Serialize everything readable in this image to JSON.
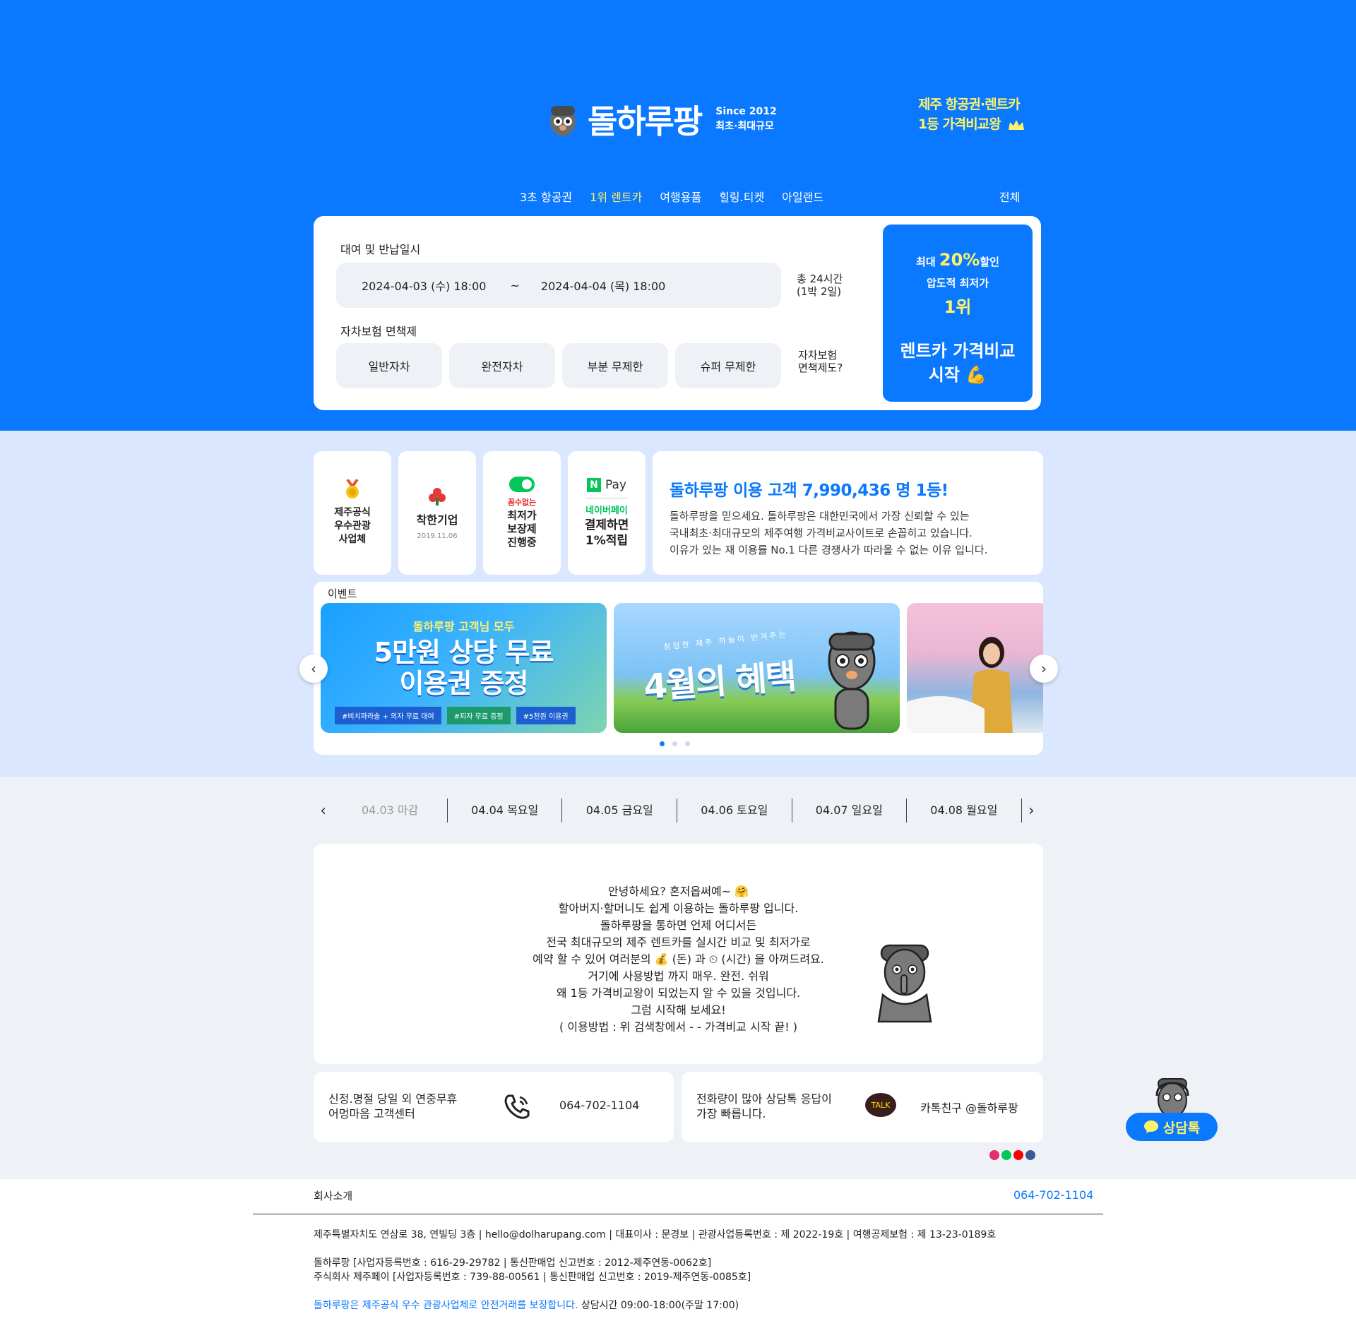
{
  "brand": {
    "name": "돌하루팡",
    "since": "Since 2012",
    "sub": "최초·최대규모",
    "tagline_1": "제주 항공권·렌트카",
    "tagline_2": "1등 가격비교왕"
  },
  "nav": {
    "items": [
      "3초 항공권",
      "1위 렌트카",
      "여행용품",
      "힐링.티켓",
      "아일랜드"
    ],
    "active_index": 1,
    "all": "전체"
  },
  "search": {
    "period_label": "대여 및 반납일시",
    "start": "2024-04-03 (수) 18:00",
    "separator": "~",
    "end": "2024-04-04 (목) 18:00",
    "total_1": "총 24시간",
    "total_2": "(1박 2일)",
    "insurance_label": "자차보험 면책제",
    "insurance_options": [
      "일반자차",
      "완전자차",
      "부분 무제한",
      "슈퍼 무제한"
    ],
    "insurance_q1": "자차보험",
    "insurance_q2": "면책제도?"
  },
  "cta": {
    "l1_pre": "최대 ",
    "l1_pct": "20%",
    "l1_post": "할인",
    "l2": "압도적 최저가",
    "l3": "1위",
    "l4a": "렌트카 가격비교",
    "l4b": "시작 💪"
  },
  "badges": {
    "b1": "제주공식\n우수관광\n사업체",
    "b2": "착한기업",
    "b2_date": "2019.11.06",
    "b3_small": "꼼수없는",
    "b3": "최저가\n보장제\n진행중",
    "b4_pay": "Pay",
    "b4_n": "N",
    "b4_green": "네이버페이",
    "b4": "결제하면\n1%적립"
  },
  "info": {
    "headline": "돌하루팡 이용 고객 7,990,436 명  1등!",
    "line1": "돌하루팡을 믿으세요. 돌하루팡은 대한민국에서 가장 신뢰할 수 있는",
    "line2": "국내최초·최대규모의 제주여행 가격비교사이트로 손꼽히고 있습니다.",
    "line3": "이유가 있는 재 이용률 No.1 다른 경쟁사가 따라올 수 없는 이유 입니다."
  },
  "events": {
    "title": "이벤트",
    "b1_top": "돌하루팡 고객님 모두",
    "b1_main_1": "5만원 상당 무료",
    "b1_main_2": "이용권 증정",
    "b1_tags": [
      "#비치파라솔 + 의자 무료 대여",
      "#피자 무료 증정",
      "#5천원 이용권"
    ],
    "b2_top": "청정한 제주 하늘이 반겨주는",
    "b2_main": "4월의 혜택",
    "prev": "‹",
    "next": "›"
  },
  "date_tabs": {
    "prev": "‹",
    "next": "›",
    "items": [
      "04.03 마감",
      "04.04 목요일",
      "04.05 금요일",
      "04.06 토요일",
      "04.07 일요일",
      "04.08 월요일"
    ]
  },
  "intro": {
    "lines": [
      "안녕하세요? 혼저옵써예~ 🤗",
      "할아버지·할머니도 쉽게 이용하는 돌하루팡 입니다.",
      "돌하루팡을 통하면 언제 어디서든",
      "전국 최대규모의 제주 렌트카를 실시간 비교 및 최저가로",
      "예약 할 수 있어 여러분의 💰 (돈) 과 ⏲ (시간) 을 아껴드려요.",
      "거기에 사용방법 까지 매우. 완전. 쉬워",
      "왜 1등 가격비교왕이 되었는지 알 수 있을 것입니다.",
      "그럼 시작해 보세요!",
      "( 이용방법 : 위 검색창에서  -  - 가격비교 시작  끝! )"
    ]
  },
  "contact": {
    "c1_l1": "신정.명절 당일 외 연중무휴",
    "c1_l2": "어멍마음 고객센터",
    "phone": "064-702-1104",
    "c2_l1": "전화량이 많아 상담톡 응답이",
    "c2_l2": "가장 빠릅니다.",
    "talk": "TALK",
    "kakao": "카톡친구 @돌하루팡"
  },
  "float_chat": "상담톡",
  "footer": {
    "about": "회사소개",
    "phone": "064-702-1104",
    "row1": "제주특별자치도 연삼로 38, 연빌딩 3층   |   hello@dolharupang.com   |   대표이사 : 문경보   |   관광사업등록번호 : 제 2022-19호   |   여행공제보험 : 제 13-23-0189호",
    "row2": "돌하루팡   [사업자등록번호 : 616-29-29782   |   통신판매업 신고번호 : 2012-제주연동-0062호]",
    "row3": "주식회사 제주페이   [사업자등록번호 : 739-88-00561   |   통신판매업 신고번호 : 2019-제주연동-0085호]",
    "row4_blue": "돌하루팡은 제주공식 우수 관광사업체로 안전거래를 보장합니다.",
    "row4_rest": " 상담시간 09:00-18:00(주말 17:00)"
  },
  "colors": {
    "primary": "#0a78ff",
    "accent": "#fff36a",
    "band": "#dbe7ff",
    "bg": "#eef2f6"
  }
}
